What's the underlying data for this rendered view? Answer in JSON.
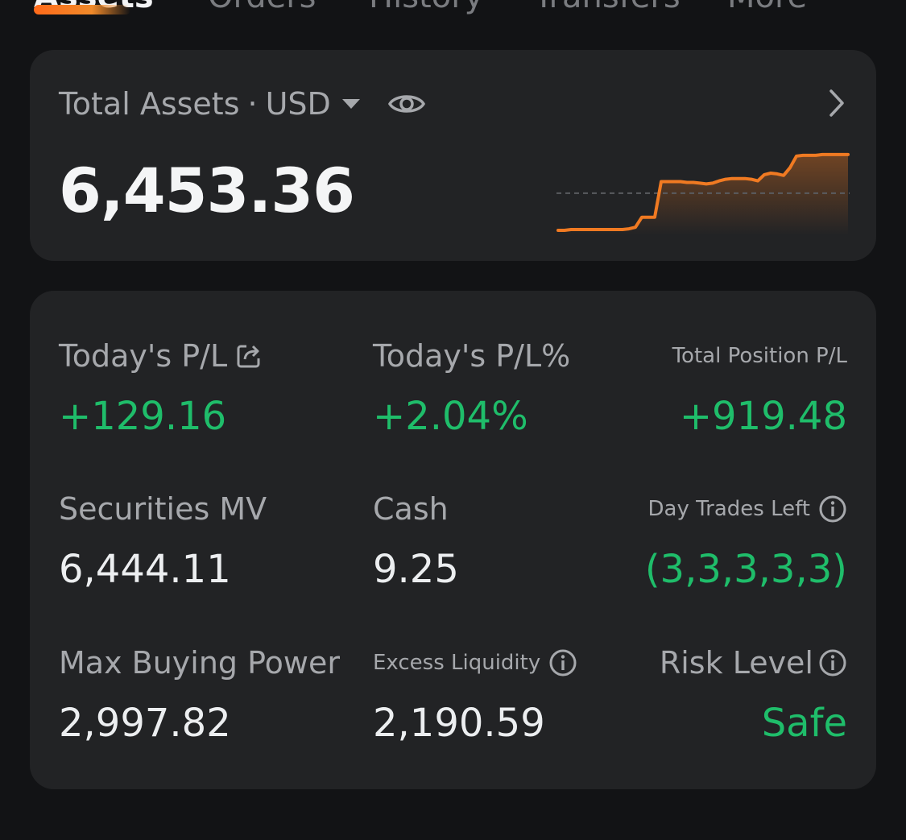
{
  "tabs": [
    {
      "label": "Assets",
      "active": true
    },
    {
      "label": "Orders",
      "active": false
    },
    {
      "label": "History",
      "active": false
    },
    {
      "label": "Transfers",
      "active": false
    },
    {
      "label": "More",
      "active": false
    }
  ],
  "total_assets": {
    "label": "Total Assets",
    "separator": "·",
    "currency": "USD",
    "value": "6,453.36",
    "icons": {
      "currency_dropdown": "caret-down-icon",
      "visibility": "eye-icon",
      "navigate": "chevron-right-icon"
    }
  },
  "metrics": {
    "todays_pl": {
      "label": "Today's P/L",
      "value": "+129.16",
      "icon": "share-icon"
    },
    "todays_pl_pct": {
      "label": "Today's P/L%",
      "value": "+2.04%"
    },
    "total_position_pl": {
      "label": "Total Position P/L",
      "value": "+919.48"
    },
    "securities_mv": {
      "label": "Securities MV",
      "value": "6,444.11"
    },
    "cash": {
      "label": "Cash",
      "value": "9.25"
    },
    "day_trades_left": {
      "label": "Day Trades Left",
      "value": "(3,3,3,3,3)",
      "icon": "info-icon"
    },
    "max_buying_power": {
      "label": "Max Buying Power",
      "value": "2,997.82"
    },
    "excess_liquidity": {
      "label": "Excess Liquidity",
      "value": "2,190.59",
      "icon": "info-icon"
    },
    "risk_level": {
      "label": "Risk Level",
      "value": "Safe",
      "icon": "info-icon"
    }
  },
  "colors": {
    "background": "#121315",
    "card": "#222325",
    "positive": "#1fbd6a",
    "accent": "#f07a22",
    "label": "#a6a8ac",
    "value": "#eceef0"
  },
  "chart_data": {
    "type": "line",
    "title": "",
    "values": [
      0,
      0,
      0.01,
      0.01,
      0.01,
      0.01,
      0.01,
      0.01,
      0.01,
      0.01,
      0.01,
      0.02,
      0.04,
      0.17,
      0.17,
      0.17,
      0.63,
      0.63,
      0.63,
      0.63,
      0.62,
      0.62,
      0.61,
      0.6,
      0.61,
      0.64,
      0.66,
      0.67,
      0.67,
      0.67,
      0.66,
      0.64,
      0.72,
      0.74,
      0.73,
      0.71,
      0.81,
      0.96,
      0.97,
      0.97,
      0.97,
      0.98,
      0.98,
      0.98,
      0.98,
      0.98
    ],
    "baseline": 0.48,
    "baseline_style": "dashed",
    "fill": "gradient",
    "grid": false,
    "legend": "none"
  }
}
